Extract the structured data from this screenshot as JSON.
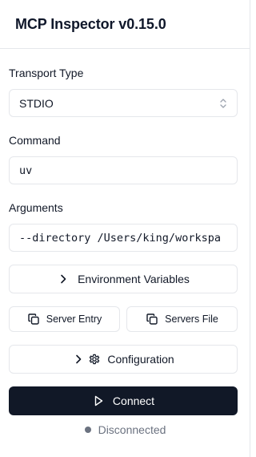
{
  "header": {
    "title": "MCP Inspector v0.15.0"
  },
  "transport": {
    "label": "Transport Type",
    "value": "STDIO"
  },
  "command": {
    "label": "Command",
    "value": "uv"
  },
  "arguments": {
    "label": "Arguments",
    "value": "--directory /Users/king/workspa"
  },
  "buttons": {
    "env_vars": "Environment Variables",
    "server_entry": "Server Entry",
    "servers_file": "Servers File",
    "configuration": "Configuration",
    "connect": "Connect"
  },
  "status": {
    "text": "Disconnected",
    "dot_color": "#6b7280"
  },
  "colors": {
    "primary": "#111827",
    "border": "#e5e7eb",
    "muted": "#6b7280"
  }
}
